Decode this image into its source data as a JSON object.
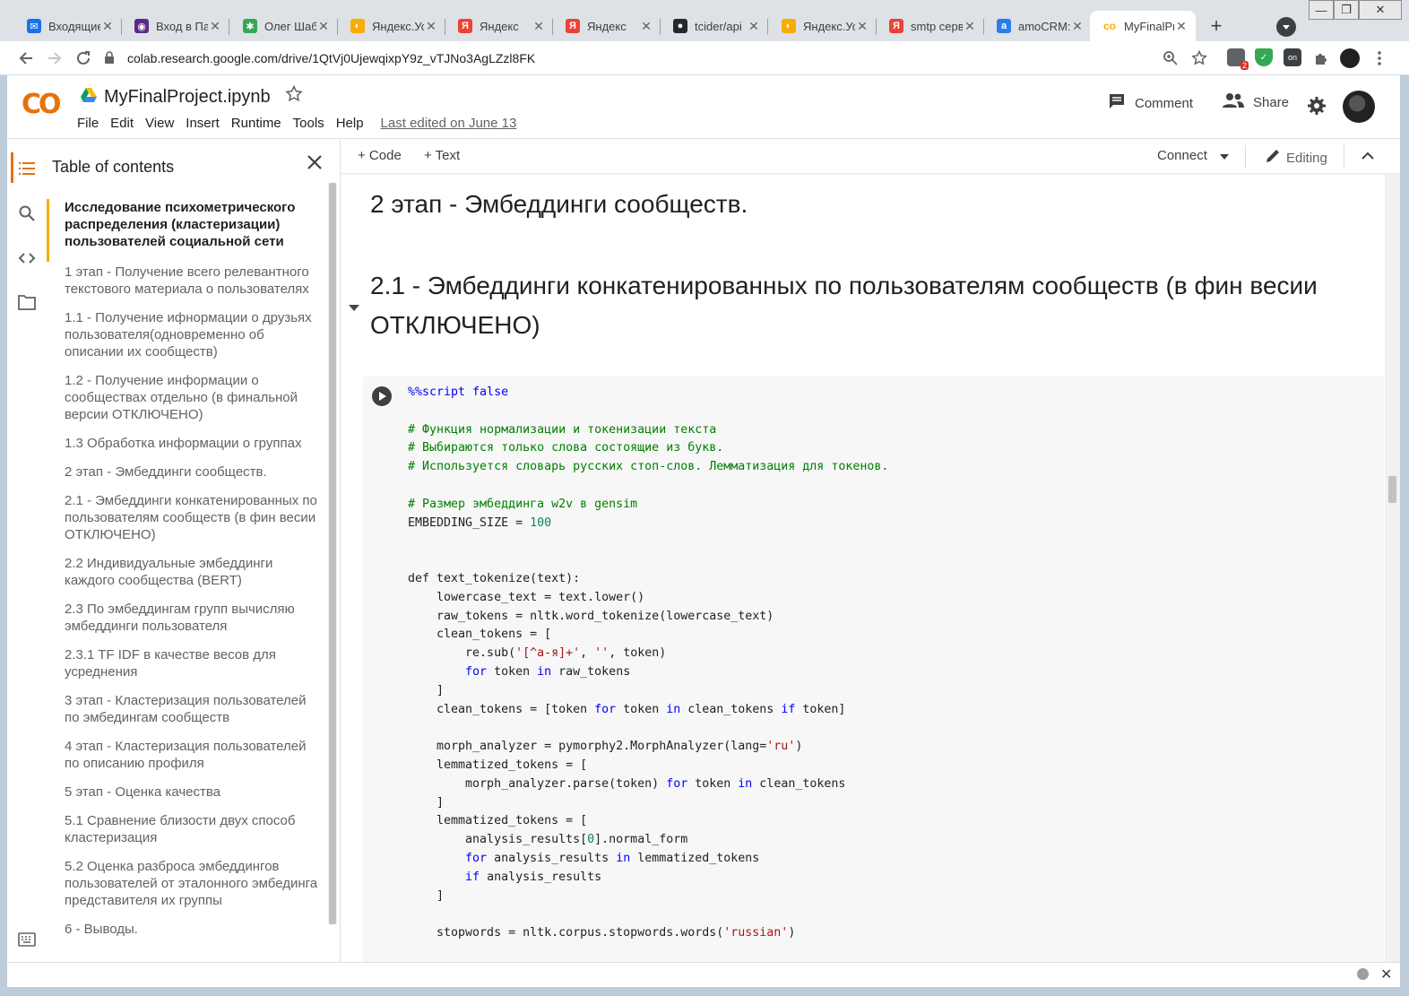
{
  "browser": {
    "tabs": [
      {
        "title": "Входящие",
        "favicon": "mail-icon",
        "color": "#1a73e8",
        "glyph": "✉"
      },
      {
        "title": "Вход в Па",
        "favicon": "paypal-icon",
        "color": "#5b2a86",
        "glyph": "◉"
      },
      {
        "title": "Олег Шаб",
        "favicon": "vk-icon",
        "color": "#34a853",
        "glyph": "✱"
      },
      {
        "title": "Яндекс.Ус",
        "favicon": "yandex-browser-icon",
        "color": "#f9ab00",
        "glyph": "◐"
      },
      {
        "title": "Яндекс",
        "favicon": "yandex-icon",
        "color": "#ea4335",
        "glyph": "Я"
      },
      {
        "title": "Яндекс",
        "favicon": "yandex-icon",
        "color": "#ea4335",
        "glyph": "Я"
      },
      {
        "title": "tcider/api",
        "favicon": "github-icon",
        "color": "#24292e",
        "glyph": "●"
      },
      {
        "title": "Яндекс.Ус",
        "favicon": "yandex-browser-icon",
        "color": "#f9ab00",
        "glyph": "◐"
      },
      {
        "title": "smtp серв",
        "favicon": "yandex-icon",
        "color": "#ea4335",
        "glyph": "Я"
      },
      {
        "title": "amoCRM:",
        "favicon": "amocrm-icon",
        "color": "#2b7de9",
        "glyph": "a"
      },
      {
        "title": "MyFinalPr",
        "favicon": "colab-icon",
        "color": "#f9ab00",
        "glyph": "co",
        "active": true
      }
    ],
    "new_tab": "+",
    "url": "colab.research.google.com/drive/1QtVj0UjewqixpY9z_vTJNo3AgLZzl8FK",
    "extension_badge": "2"
  },
  "header": {
    "logo": "CO",
    "notebook_title": "MyFinalProject.ipynb",
    "menu": [
      "File",
      "Edit",
      "View",
      "Insert",
      "Runtime",
      "Tools",
      "Help"
    ],
    "last_edited": "Last edited on June 13",
    "comment_label": "Comment",
    "share_label": "Share"
  },
  "toc": {
    "title": "Table of contents",
    "items": [
      "Исследование психометрического распределения (кластеризации) пользователей социальной сети",
      "1 этап - Получение всего релевантного текстового материала о пользователях",
      "1.1 - Получение ифнормации о друзьях пользователя(одновременно об описании их сообществ)",
      "1.2 - Получение информации о сообществах отдельно (в финальной версии ОТКЛЮЧЕНО)",
      "1.3 Обработка информации о группах",
      "2 этап - Эмбеддинги сообществ.",
      "2.1 - Эмбеддинги конкатенированных по пользователям сообществ (в фин весии ОТКЛЮЧЕНО)",
      "2.2 Индивидуальные эмбеддинги каждого сообщества (BERT)",
      "2.3 По эмбеддингам групп вычисляю эмбеддинги пользователя",
      "2.3.1 TF IDF в качестве весов для усреднения",
      "3 этап - Кластеризация пользователей по эмбедингам сообществ",
      "4 этап - Кластеризация пользователей по описанию профиля",
      "5 этап - Оценка качества",
      "5.1 Сравнение близости двух способ кластеризация",
      "5.2 Оценка разброса эмбеддингов пользователей от эталонного эмбединга представителя их группы",
      "6 - Выводы."
    ]
  },
  "notebook_toolbar": {
    "add_code": "+ Code",
    "add_text": "+ Text",
    "connect": "Connect",
    "editing": "Editing"
  },
  "content": {
    "heading1": "2 этап - Эмбеддинги сообществ.",
    "heading2": "2.1 - Эмбеддинги конкатенированных по пользователям сообществ (в фин весии ОТКЛЮЧЕНО)"
  },
  "code": {
    "magic": "%%script false",
    "comment1": "# Функция нормализации и токенизации текста",
    "comment2": "# Выбираются только слова состоящие из букв.",
    "comment3": "# Используется словарь русских стоп-слов. Лемматизация для токенов.",
    "comment4": "# Размер эмбеддинга w2v в gensim",
    "embedding_var": "EMBEDDING_SIZE = ",
    "embedding_val": "100"
  }
}
